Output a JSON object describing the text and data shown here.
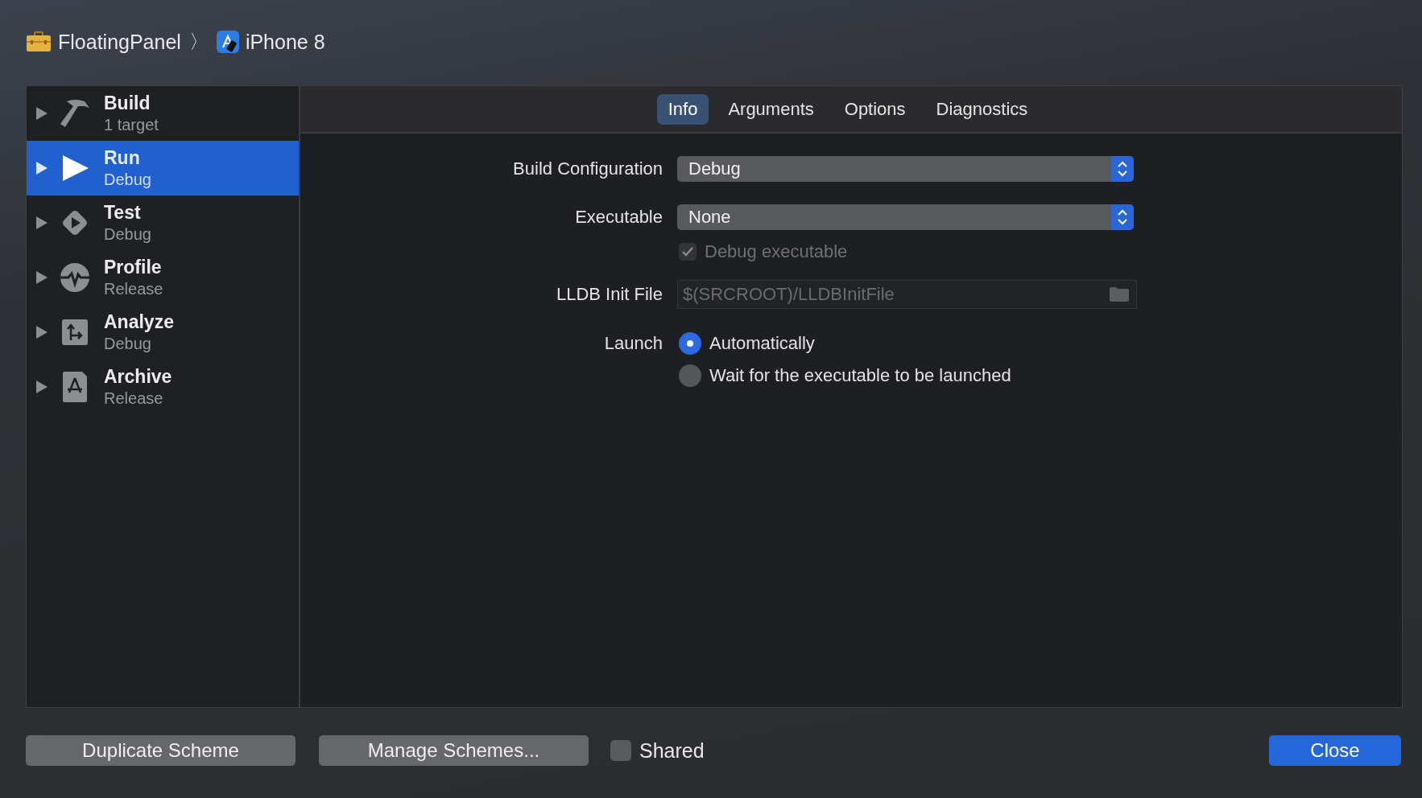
{
  "breadcrumb": {
    "project": "FloatingPanel",
    "separator": "〉",
    "device": "iPhone 8"
  },
  "sidebar": {
    "items": [
      {
        "title": "Build",
        "subtitle": "1 target",
        "selected": false
      },
      {
        "title": "Run",
        "subtitle": "Debug",
        "selected": true
      },
      {
        "title": "Test",
        "subtitle": "Debug",
        "selected": false
      },
      {
        "title": "Profile",
        "subtitle": "Release",
        "selected": false
      },
      {
        "title": "Analyze",
        "subtitle": "Debug",
        "selected": false
      },
      {
        "title": "Archive",
        "subtitle": "Release",
        "selected": false
      }
    ]
  },
  "tabs": [
    {
      "label": "Info",
      "selected": true
    },
    {
      "label": "Arguments",
      "selected": false
    },
    {
      "label": "Options",
      "selected": false
    },
    {
      "label": "Diagnostics",
      "selected": false
    }
  ],
  "form": {
    "build_configuration": {
      "label": "Build Configuration",
      "value": "Debug"
    },
    "executable": {
      "label": "Executable",
      "value": "None"
    },
    "debug_executable": {
      "label": "Debug executable",
      "checked": true,
      "disabled": true
    },
    "lldb_init_file": {
      "label": "LLDB Init File",
      "placeholder": "$(SRCROOT)/LLDBInitFile"
    },
    "launch": {
      "label": "Launch",
      "options": [
        {
          "label": "Automatically",
          "selected": true
        },
        {
          "label": "Wait for the executable to be launched",
          "selected": false
        }
      ]
    }
  },
  "footer": {
    "duplicate_button": "Duplicate Scheme",
    "manage_button": "Manage Schemes...",
    "shared": {
      "label": "Shared",
      "checked": false
    },
    "close_button": "Close"
  }
}
